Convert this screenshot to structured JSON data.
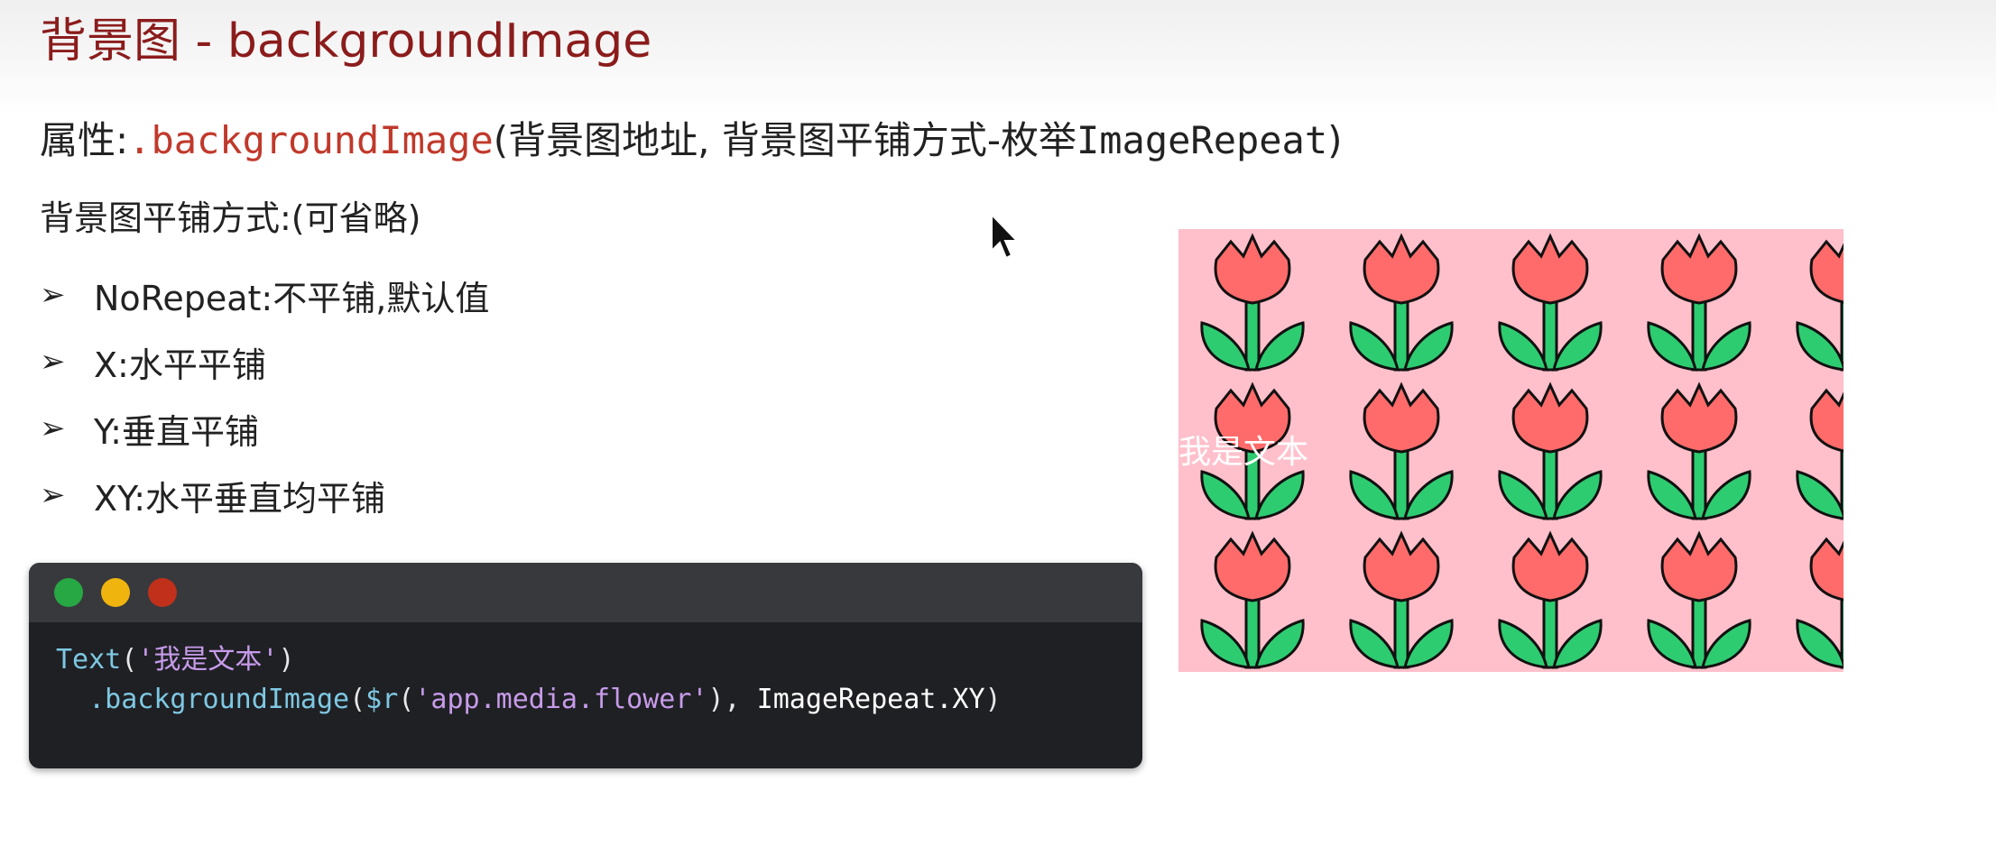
{
  "slide": {
    "title": "背景图 - backgroundImage",
    "property": {
      "label": "属性:",
      "method": ".backgroundImage",
      "args_open": "(背景图地址, 背景图平铺方式-枚举",
      "enum_name": "ImageRepeat",
      "args_close": ")"
    },
    "repeat_heading": "背景图平铺方式:(可省略)",
    "options": [
      {
        "icon": "arrow-bullet-icon",
        "text": "NoRepeat:不平铺,默认值"
      },
      {
        "icon": "arrow-bullet-icon",
        "text": "X:水平平铺"
      },
      {
        "icon": "arrow-bullet-icon",
        "text": "Y:垂直平铺"
      },
      {
        "icon": "arrow-bullet-icon",
        "text": "XY:水平垂直均平铺"
      }
    ]
  },
  "code_window": {
    "dots": {
      "green": "#27a844",
      "yellow": "#f0b40e",
      "red": "#c0301b"
    },
    "line1": {
      "fn": "Text",
      "open": "(",
      "str": "'我是文本'",
      "close": ")"
    },
    "line2": {
      "method": ".backgroundImage",
      "open": "(",
      "res_fn": "$r",
      "res_open": "(",
      "res_str": "'app.media.flower'",
      "res_close": "),",
      "enum": " ImageRepeat.XY",
      "close": ")"
    }
  },
  "preview": {
    "text": "我是文本",
    "background_color": "#ffc0cb",
    "tile_icon": "tulip-icon"
  },
  "colors": {
    "title": "#8b1c1c",
    "method": "#c0392b",
    "code_bg": "#1f2024"
  }
}
